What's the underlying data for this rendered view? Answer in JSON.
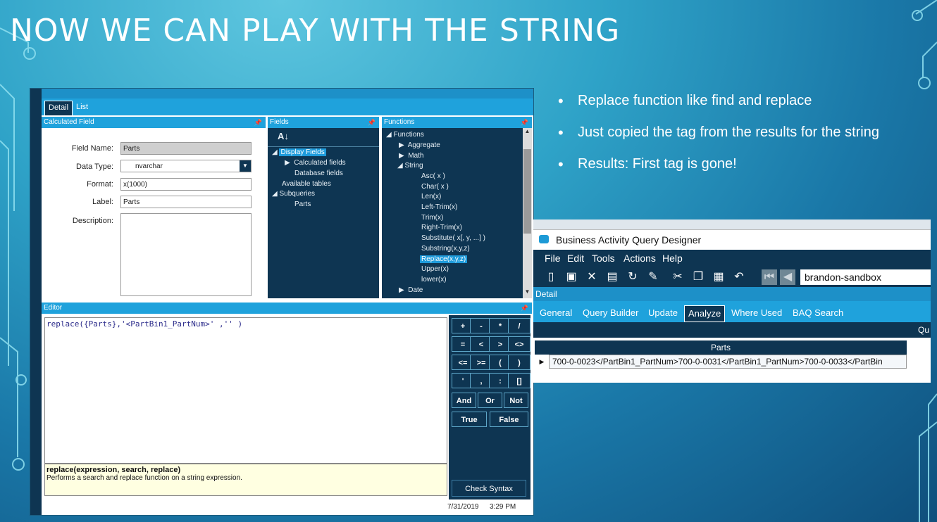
{
  "slide": {
    "title": "NOW WE CAN PLAY WITH THE STRING",
    "bullets": [
      "Replace function like find and replace",
      "Just copied the tag from the results for the string",
      "Results: First tag is gone!"
    ]
  },
  "left_window": {
    "tabs": [
      "Detail",
      "List"
    ],
    "active_tab": "Detail",
    "calc_panel": {
      "title": "Calculated Field",
      "field_name_label": "Field Name:",
      "field_name_value": "Parts",
      "data_type_label": "Data Type:",
      "data_type_value": "nvarchar",
      "format_label": "Format:",
      "format_value": "x(1000)",
      "label_label": "Label:",
      "label_value": "Parts",
      "description_label": "Description:"
    },
    "fields_panel": {
      "title": "Fields",
      "sort_icon": "AZ-sort-icon",
      "items": [
        "Display Fields",
        "Calculated fields",
        "Database fields",
        "Available tables",
        "Subqueries",
        "Parts"
      ]
    },
    "functions_panel": {
      "title": "Functions",
      "root": "Functions",
      "groups": [
        "Aggregate",
        "Math",
        "String"
      ],
      "string_items": [
        "Asc( x )",
        "Char( x )",
        "Len(x)",
        "Left-Trim(x)",
        "Trim(x)",
        "Right-Trim(x)",
        "Substitute( x[, y, ...] )",
        "Substring(x,y,z)",
        "Replace(x,y,z)",
        "Upper(x)",
        "lower(x)"
      ],
      "selected": "Replace(x,y,z)",
      "last_group": "Date"
    },
    "editor": {
      "title": "Editor",
      "expression": "replace({Parts},'<PartBin1_PartNum>' ,'' )",
      "help_signature": "replace(expression, search, replace)",
      "help_text": "Performs a search and replace function on a string expression."
    },
    "keypad": {
      "keys": [
        "+",
        "-",
        "*",
        "/",
        "=",
        "<",
        ">",
        "<>",
        "<=",
        ">=",
        "(",
        ")",
        "'",
        ",",
        ":",
        "[]"
      ],
      "logic_keys": [
        "And",
        "Or",
        "Not"
      ],
      "bool_keys": [
        "True",
        "False"
      ],
      "check_syntax": "Check Syntax"
    },
    "status": {
      "date": "7/31/2019",
      "time": "3:29 PM"
    }
  },
  "right_window": {
    "title": "Business Activity Query Designer",
    "menu": [
      "File",
      "Edit",
      "Tools",
      "Actions",
      "Help"
    ],
    "company": "brandon-sandbox",
    "detail_label": "Detail",
    "tabs": [
      "General",
      "Query Builder",
      "Update",
      "Analyze",
      "Where Used",
      "BAQ Search"
    ],
    "active_tab": "Analyze",
    "side_label": "Qu",
    "grid": {
      "column": "Parts",
      "row": "700-0-0023</PartBin1_PartNum>700-0-0031</PartBin1_PartNum>700-0-0033</PartBin"
    }
  }
}
